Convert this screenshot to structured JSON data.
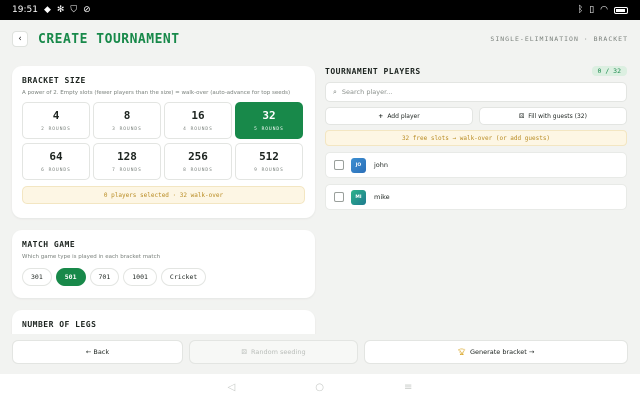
{
  "status_bar": {
    "time": "19:51",
    "icons_left": [
      "android-notification-icon",
      "gear-icon",
      "shield-icon",
      "blocked-icon"
    ],
    "icons_right": [
      "bluetooth-icon",
      "vibrate-icon",
      "wifi-icon",
      "battery-icon"
    ]
  },
  "header": {
    "back_icon": "chevron-left-icon",
    "title": "CREATE TOURNAMENT",
    "mode": "SINGLE-ELIMINATION · BRACKET"
  },
  "bracket_size": {
    "title": "BRACKET SIZE",
    "description": "A power of 2. Empty slots (fewer players than the size) = walk-over (auto-advance for top seeds)",
    "options": [
      {
        "size": "4",
        "rounds": "2 ROUNDS",
        "selected": false
      },
      {
        "size": "8",
        "rounds": "3 ROUNDS",
        "selected": false
      },
      {
        "size": "16",
        "rounds": "4 ROUNDS",
        "selected": false
      },
      {
        "size": "32",
        "rounds": "5 ROUNDS",
        "selected": true
      },
      {
        "size": "64",
        "rounds": "6 ROUNDS",
        "selected": false
      },
      {
        "size": "128",
        "rounds": "7 ROUNDS",
        "selected": false
      },
      {
        "size": "256",
        "rounds": "8 ROUNDS",
        "selected": false
      },
      {
        "size": "512",
        "rounds": "9 ROUNDS",
        "selected": false
      }
    ],
    "info": "0 players selected · 32 walk-over"
  },
  "match_game": {
    "title": "MATCH GAME",
    "description": "Which game type is played in each bracket match",
    "options": [
      {
        "label": "301",
        "selected": false
      },
      {
        "label": "501",
        "selected": true
      },
      {
        "label": "701",
        "selected": false
      },
      {
        "label": "1001",
        "selected": false
      },
      {
        "label": "Cricket",
        "selected": false
      }
    ]
  },
  "legs": {
    "title": "NUMBER OF LEGS"
  },
  "players": {
    "title": "TOURNAMENT PLAYERS",
    "counter": "0 / 32",
    "search_placeholder": "Search player...",
    "search_icon": "search-icon",
    "add_label": "Add player",
    "add_icon": "plus-icon",
    "fill_label": "Fill with guests (32)",
    "fill_icon": "dice-icon",
    "free_info": "32 free slots → walk-over (or add guests)",
    "list": [
      {
        "initials": "JO",
        "name": "john",
        "color": "#3d8fd1",
        "color2": "#2b6fb8"
      },
      {
        "initials": "MI",
        "name": "mike",
        "color": "#2bb38a",
        "color2": "#1f7a8f"
      }
    ]
  },
  "bottom": {
    "back_label": "← Back",
    "random_label": "Random seeding",
    "random_icon": "dice-icon",
    "generate_label": "Generate bracket →",
    "generate_icon": "trophy-icon"
  },
  "nav": {
    "back_icon": "nav-back-icon",
    "home_icon": "nav-home-icon",
    "recents_icon": "nav-recents-icon"
  },
  "colors": {
    "accent": "#18894a",
    "warning_bg": "#fdf6e4",
    "warning_text": "#b88b22",
    "background": "#f2f3f1"
  }
}
